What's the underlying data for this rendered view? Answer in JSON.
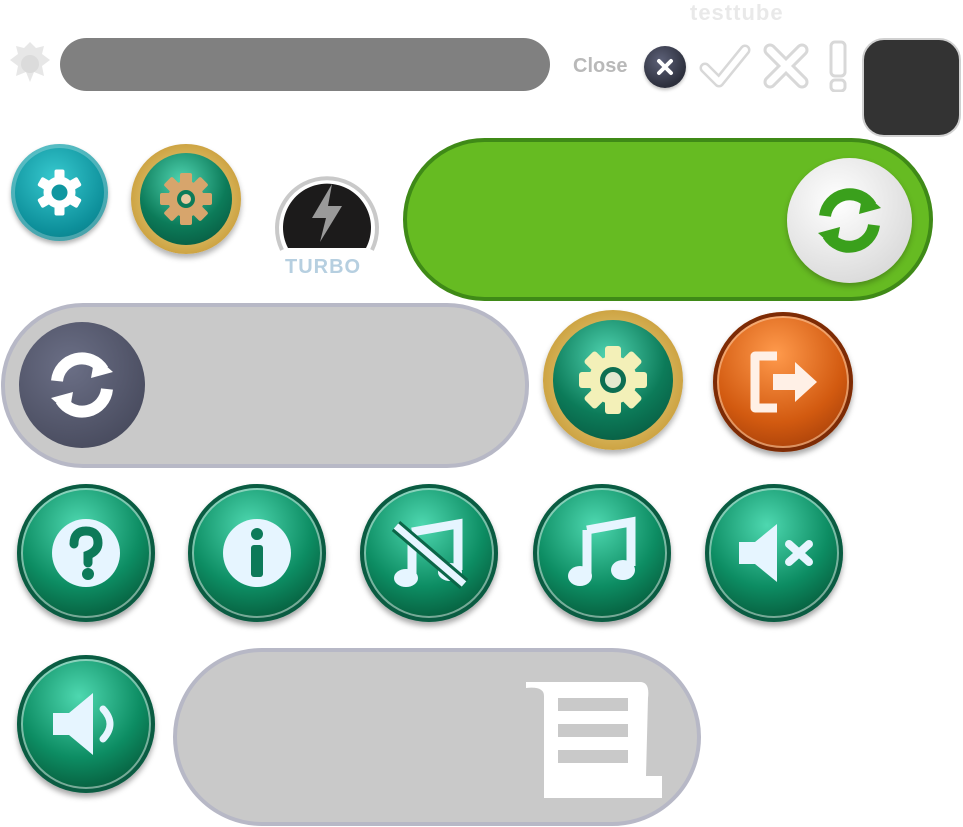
{
  "header": {
    "close_label": "Close",
    "watermark": "testtube"
  },
  "turbo": {
    "label": "TURBO"
  },
  "icons": {
    "logo": "lion-crest-logo",
    "close": "close-icon",
    "check": "checkmark-icon",
    "cross": "cross-icon",
    "alert": "exclamation-icon",
    "gear": "gear-icon",
    "lightning": "lightning-icon",
    "refresh": "refresh-icon",
    "exit": "exit-icon",
    "help": "question-icon",
    "info": "info-icon",
    "music_off": "music-off-icon",
    "music": "music-icon",
    "mute": "speaker-mute-icon",
    "volume": "speaker-icon",
    "scroll": "scroll-icon"
  },
  "colors": {
    "green_toggle": "#66bb22",
    "gray_toggle": "#c9c9c9",
    "teal": "#0d8f9a",
    "glossy_green": "#0d8d63",
    "orange": "#d25a10"
  }
}
